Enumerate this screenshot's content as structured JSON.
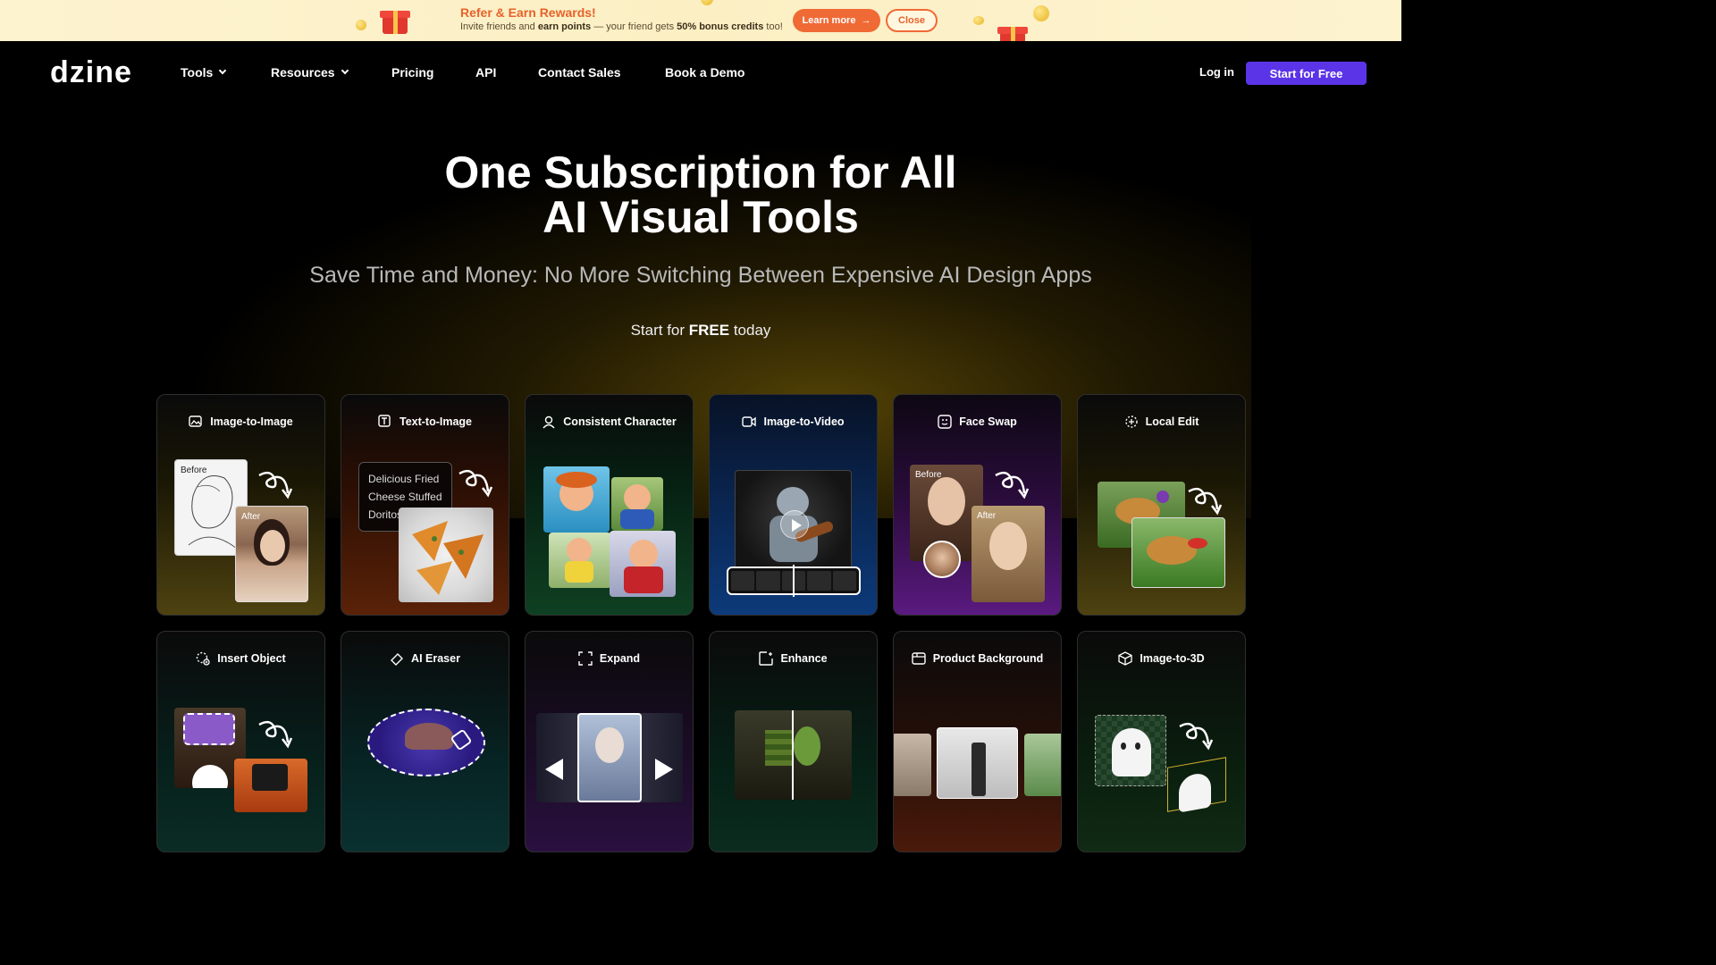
{
  "promo": {
    "title": "Refer & Earn Rewards!",
    "sub_a": "Invite friends and ",
    "sub_b": "earn points",
    "sub_c": " — your friend gets ",
    "sub_d": "50% bonus credits",
    "sub_e": " too!",
    "learn_label": "Learn more",
    "close_label": "Close"
  },
  "nav": {
    "logo": "dzine",
    "items": [
      "Tools",
      "Resources",
      "Pricing",
      "API",
      "Contact Sales",
      "Book a Demo"
    ],
    "login": "Log in",
    "start": "Start for Free"
  },
  "hero": {
    "title_line1": "One Subscription for All",
    "title_line2": "AI Visual Tools",
    "subtitle": "Save Time and Money: No More Switching Between Expensive AI Design Apps",
    "cta_a": "Start for ",
    "cta_b": "FREE",
    "cta_c": " today"
  },
  "cards": [
    {
      "label": "Image-to-Image",
      "icon": "image-edit-icon",
      "tag1": "Before",
      "tag2": "After"
    },
    {
      "label": "Text-to-Image",
      "icon": "text-image-icon",
      "prompt": "Delicious Fried Cheese Stuffed Doritos"
    },
    {
      "label": "Consistent Character",
      "icon": "character-icon"
    },
    {
      "label": "Image-to-Video",
      "icon": "video-icon"
    },
    {
      "label": "Face Swap",
      "icon": "face-swap-icon",
      "tag1": "Before",
      "tag2": "After"
    },
    {
      "label": "Local Edit",
      "icon": "local-edit-icon"
    },
    {
      "label": "Insert Object",
      "icon": "insert-object-icon"
    },
    {
      "label": "AI Eraser",
      "icon": "eraser-icon"
    },
    {
      "label": "Expand",
      "icon": "expand-icon"
    },
    {
      "label": "Enhance",
      "icon": "enhance-icon"
    },
    {
      "label": "Product Background",
      "icon": "product-icon"
    },
    {
      "label": "Image-to-3D",
      "icon": "cube-icon"
    }
  ],
  "colors": {
    "accent": "#5b34e8",
    "promo_orange": "#f06a35"
  }
}
